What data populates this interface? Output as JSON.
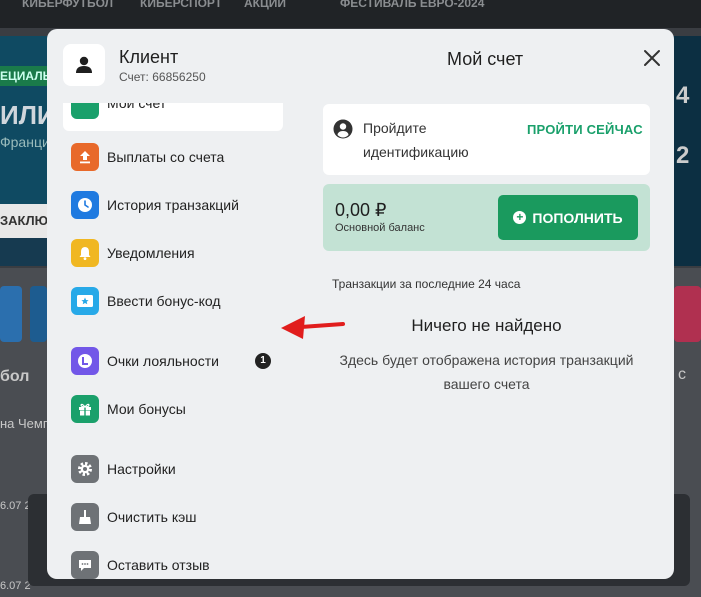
{
  "background": {
    "topbar": [
      "КИБЕРФУТБОЛ",
      "КИБЕРСПОРТ",
      "АКЦИИ",
      "ФЕСТИВАЛЬ ЕВРО-2024"
    ],
    "banner_tag": "ЕЦИАЛЬ",
    "banner_big": "ИЛИ",
    "banner_small": "Франци",
    "banner_btn": "ЗАКЛЮ",
    "right_text_1": "4",
    "right_text_2": "2",
    "section_label": "бол",
    "match_text": "на Чемп",
    "date_1": "6.07 2",
    "date_2": "6.07 2",
    "right_snip": "с"
  },
  "header": {
    "client_name": "Клиент",
    "account_label": "Счет: 66856250",
    "title": "Мой счет",
    "close_icon": "close-icon"
  },
  "sidebar": {
    "active_label": "Мой счет",
    "items": [
      {
        "label": "Выплаты со счета",
        "icon": "withdraw-icon",
        "color": "#e8692a"
      },
      {
        "label": "История транзакций",
        "icon": "clock-icon",
        "color": "#1f7ae0"
      },
      {
        "label": "Уведомления",
        "icon": "bell-icon",
        "color": "#f0b722"
      },
      {
        "label": "Ввести бонус-код",
        "icon": "bonus-code-icon",
        "color": "#27a9e8"
      },
      {
        "label": "Очки лояльности",
        "icon": "loyalty-icon",
        "color": "#7257e8",
        "badge": "1"
      },
      {
        "label": "Мои бонусы",
        "icon": "gift-icon",
        "color": "#1aa06b"
      },
      {
        "label": "Настройки",
        "icon": "gear-icon",
        "color": "#6e7276"
      },
      {
        "label": "Очистить кэш",
        "icon": "broom-icon",
        "color": "#6e7276"
      },
      {
        "label": "Оставить отзыв",
        "icon": "feedback-icon",
        "color": "#6e7276"
      }
    ]
  },
  "identification": {
    "text": "Пройдите идентификацию",
    "link": "ПРОЙТИ СЕЙЧАС"
  },
  "balance": {
    "amount": "0,00 ₽",
    "label": "Основной баланс",
    "topup": "ПОПОЛНИТЬ"
  },
  "transactions": {
    "heading": "Транзакции за последние 24 часа",
    "empty_title": "Ничего не найдено",
    "empty_desc": "Здесь будет отображена история транзакций вашего счета"
  },
  "colors": {
    "accent": "#1aa06b",
    "arrow": "#e11d1d"
  }
}
